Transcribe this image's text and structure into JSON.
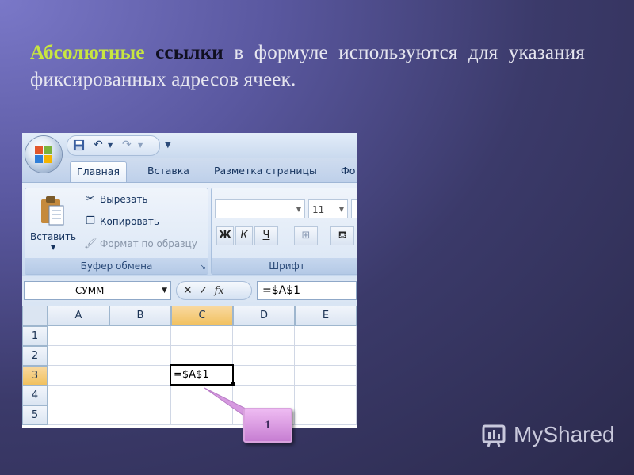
{
  "heading": {
    "word1": "Абсолютные",
    "word2": "ссылки",
    "rest": " в формуле используются для указания фиксированных адресов ячеек."
  },
  "excel": {
    "tabs": [
      "Главная",
      "Вставка",
      "Разметка страницы",
      "Фо"
    ],
    "clipboard": {
      "paste_label": "Вставить",
      "cut_label": "Вырезать",
      "copy_label": "Копировать",
      "format_painter_label": "Формат по образцу",
      "group_title": "Буфер обмена"
    },
    "font": {
      "font_size": "11",
      "bold": "Ж",
      "italic": "К",
      "underline": "Ч",
      "group_title": "Шрифт"
    },
    "formula_bar": {
      "name_box": "СУММ",
      "fx": "fx",
      "formula": "=$A$1"
    },
    "columns": [
      "A",
      "B",
      "C",
      "D",
      "E"
    ],
    "rows": [
      "1",
      "2",
      "3",
      "4",
      "5"
    ],
    "selected_column": "C",
    "selected_row": "3",
    "active_cell_value": "=$A$1"
  },
  "callout": {
    "label": "1"
  },
  "brand": {
    "name": "MyShared"
  }
}
